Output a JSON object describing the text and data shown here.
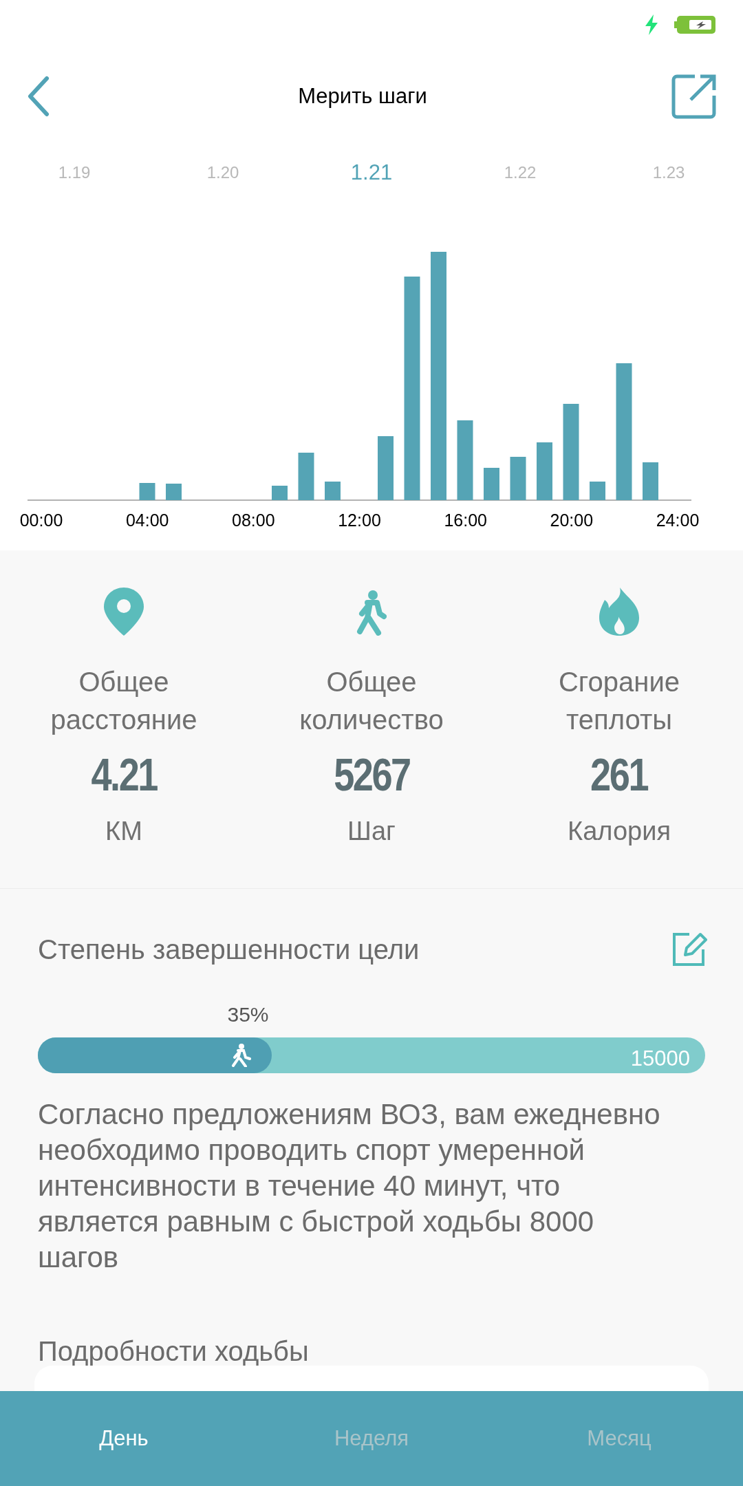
{
  "header": {
    "title": "Мерить шаги"
  },
  "dates": [
    {
      "label": "1.19",
      "selected": false
    },
    {
      "label": "1.20",
      "selected": false
    },
    {
      "label": "1.21",
      "selected": true
    },
    {
      "label": "1.22",
      "selected": false
    },
    {
      "label": "1.23",
      "selected": false
    }
  ],
  "chart": {
    "x_labels": [
      "00:00",
      "04:00",
      "08:00",
      "12:00",
      "16:00",
      "20:00",
      "24:00"
    ]
  },
  "stats": [
    {
      "kind": "distance",
      "label": "Общее расстояние",
      "value": "4.21",
      "unit": "КМ"
    },
    {
      "kind": "steps",
      "label": "Общее количество",
      "value": "5267",
      "unit": "Шаг"
    },
    {
      "kind": "calories",
      "label": "Сгорание теплоты",
      "value": "261",
      "unit": "Калория"
    }
  ],
  "goal": {
    "title": "Степень завершенности цели",
    "percent": "35%",
    "level": 0.35,
    "target": "15000",
    "note": "Согласно предложениям ВОЗ, вам ежедневно необходимо проводить спорт умеренной интенсивности в течение 40 минут, что является равным с быстрой ходьбы 8000 шагов"
  },
  "details": {
    "title": "Подробности ходьбы"
  },
  "bottom_tabs": [
    {
      "label": "День",
      "selected": true
    },
    {
      "label": "Неделя",
      "selected": false
    },
    {
      "label": "Месяц",
      "selected": false
    }
  ]
}
